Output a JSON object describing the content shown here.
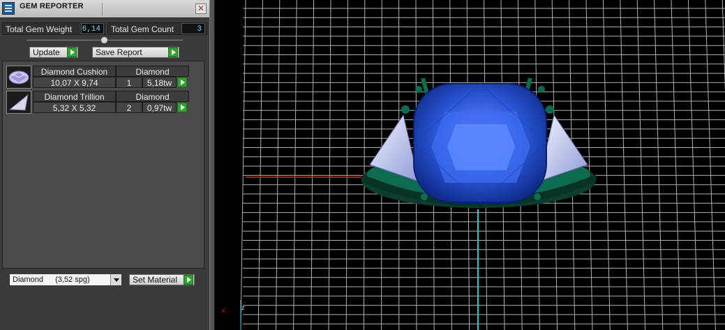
{
  "window": {
    "title": "GEM REPORTER",
    "close_glyph": "✕"
  },
  "stats": {
    "weight_label": "Total Gem Weight",
    "weight_value": "6,14",
    "count_label": "Total Gem Count",
    "count_value": "3"
  },
  "toolbar": {
    "update_label": "Update",
    "save_label": "Save Report"
  },
  "gems": [
    {
      "name": "Diamond Cushion",
      "material": "Diamond",
      "size": "10,07 X 9,74",
      "count": "1",
      "weight": "5,18tw",
      "thumb_icon": "cushion-gem-icon"
    },
    {
      "name": "Diamond Trillion",
      "material": "Diamond",
      "size": "5,32 X 5,32",
      "count": "2",
      "weight": "0,97tw",
      "thumb_icon": "trillion-gem-icon"
    }
  ],
  "material": {
    "selected_name": "Diamond",
    "selected_density": "(3,52 spg)",
    "set_label": "Set Material"
  },
  "viewport": {
    "axis_x_label": "x",
    "axis_z_label": "z"
  },
  "colors": {
    "accent_go": "#2fa52f",
    "stone": "#1c4fd4",
    "metal": "#0f6a52",
    "grid": "#cfcfcf",
    "value_text": "#69d3e6"
  }
}
